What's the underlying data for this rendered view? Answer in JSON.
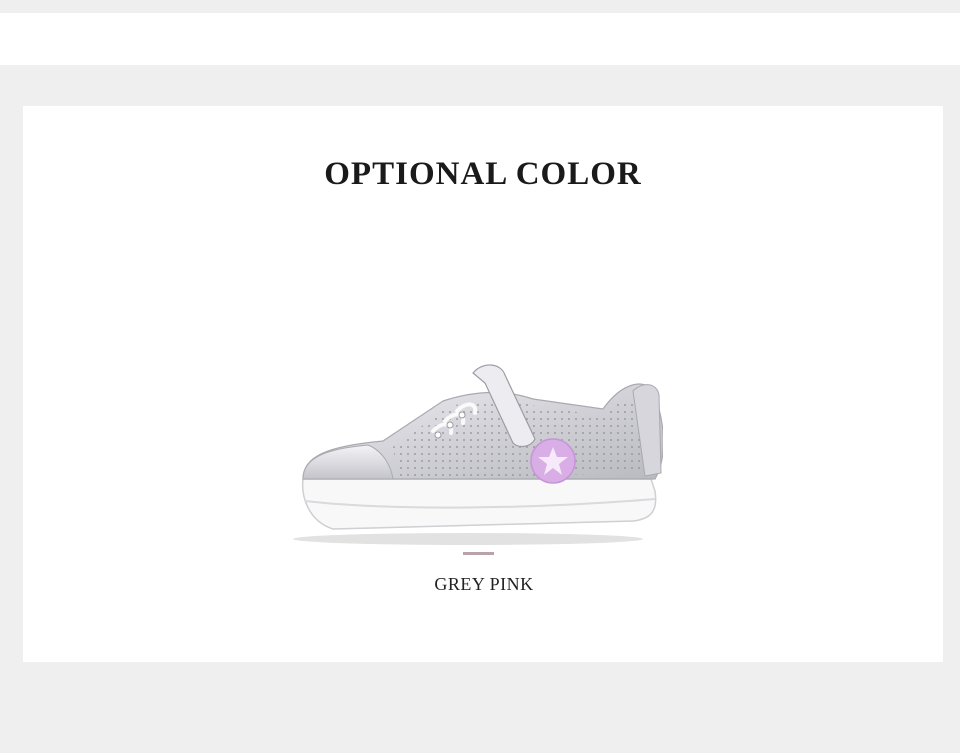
{
  "section": {
    "title": "OPTIONAL COLOR"
  },
  "product": {
    "image_icon": "sneaker-image",
    "color_name": "GREY PINK",
    "swatch_color": "#b9a2ab",
    "badge_color": "#d9aee6"
  },
  "colors": {
    "page_background": "#efefef",
    "card_background": "#ffffff",
    "title_color": "#1a1a1a"
  }
}
